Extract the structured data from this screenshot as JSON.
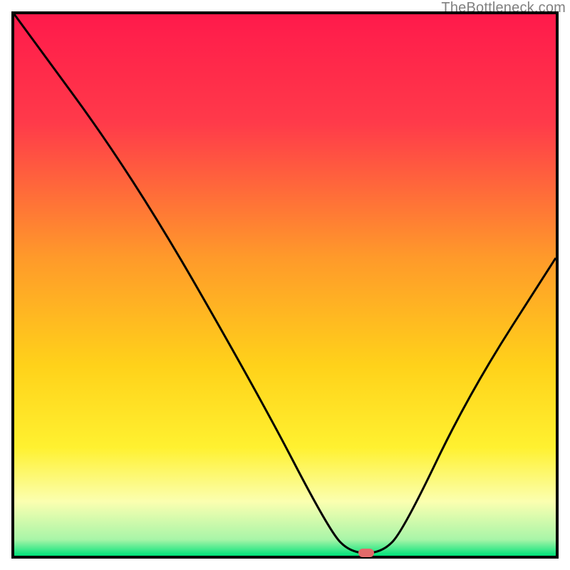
{
  "watermark": "TheBottleneck.com",
  "chart_data": {
    "type": "line",
    "title": "",
    "xlabel": "",
    "ylabel": "",
    "xlim": [
      0,
      100
    ],
    "ylim": [
      0,
      100
    ],
    "gradient_stops": [
      {
        "pct": 0,
        "color": "#ff1a4b"
      },
      {
        "pct": 20,
        "color": "#ff3a4a"
      },
      {
        "pct": 45,
        "color": "#ff9a2a"
      },
      {
        "pct": 65,
        "color": "#ffd21a"
      },
      {
        "pct": 80,
        "color": "#fff130"
      },
      {
        "pct": 90,
        "color": "#fbffb0"
      },
      {
        "pct": 97,
        "color": "#a8f5a8"
      },
      {
        "pct": 100,
        "color": "#00e27a"
      }
    ],
    "curve_points": [
      {
        "x": 0,
        "y": 100
      },
      {
        "x": 22,
        "y": 70
      },
      {
        "x": 45,
        "y": 30
      },
      {
        "x": 58,
        "y": 5
      },
      {
        "x": 62,
        "y": 0.5
      },
      {
        "x": 68,
        "y": 0.5
      },
      {
        "x": 72,
        "y": 5
      },
      {
        "x": 84,
        "y": 30
      },
      {
        "x": 100,
        "y": 55
      }
    ],
    "marker": {
      "x": 65,
      "y": 0.5,
      "color": "#e26a6a"
    }
  }
}
